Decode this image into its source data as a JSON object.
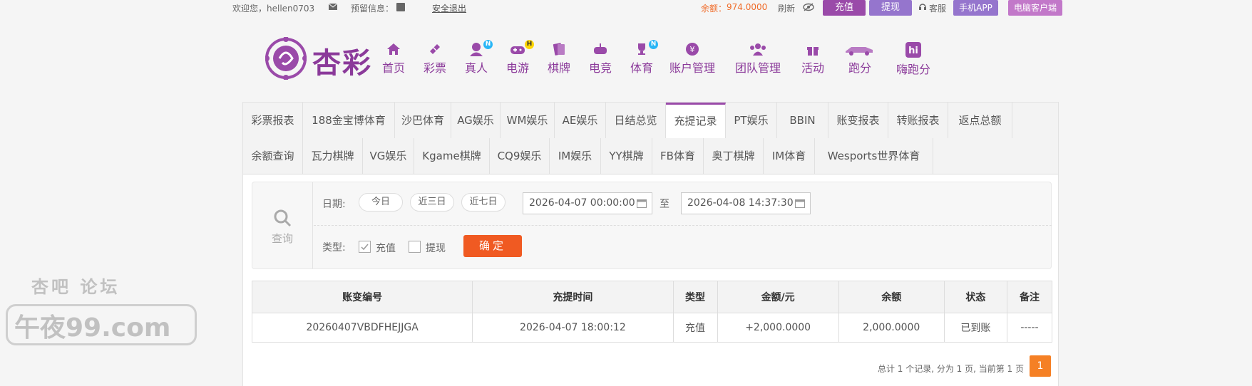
{
  "topbar": {
    "welcome": "欢迎您，hellen0703",
    "notice": "预留信息：",
    "logout": "安全退出",
    "balance_label": "余额：",
    "balance_value": "974.0000",
    "refresh": "刷新",
    "deposit": "充值",
    "withdraw": "提现",
    "service": "客服",
    "app": "手机APP",
    "pc_client": "电脑客户端"
  },
  "brand": {
    "logo_text": "杏彩"
  },
  "nav": [
    {
      "label": "首页",
      "icon": "home-icon"
    },
    {
      "label": "彩票",
      "icon": "lottery-icon"
    },
    {
      "label": "真人",
      "icon": "live-dealer-icon",
      "badge": "N"
    },
    {
      "label": "电游",
      "icon": "gamepad-icon",
      "badge": "H"
    },
    {
      "label": "棋牌",
      "icon": "cards-icon"
    },
    {
      "label": "电竞",
      "icon": "esports-icon"
    },
    {
      "label": "体育",
      "icon": "trophy-icon",
      "badge": "N"
    },
    {
      "label": "账户管理",
      "icon": "account-icon"
    },
    {
      "label": "团队管理",
      "icon": "team-icon"
    },
    {
      "label": "活动",
      "icon": "gift-icon"
    },
    {
      "label": "跑分",
      "icon": "racecar-icon"
    },
    {
      "label": "嗨跑分",
      "icon": "hi-icon"
    }
  ],
  "tabs_row1": [
    "彩票报表",
    "188金宝博体育",
    "沙巴体育",
    "AG娱乐",
    "WM娱乐",
    "AE娱乐",
    "日结总览",
    "充提记录",
    "PT娱乐",
    "BBIN",
    "账变报表",
    "转账报表",
    "返点总额"
  ],
  "tabs_row2": [
    "余额查询",
    "瓦力棋牌",
    "VG娱乐",
    "Kgame棋牌",
    "CQ9娱乐",
    "IM娱乐",
    "YY棋牌",
    "FB体育",
    "奥丁棋牌",
    "IM体育",
    "Wesports世界体育"
  ],
  "active_tab": "充提记录",
  "filter": {
    "query_label": "查询",
    "date_label": "日期:",
    "quick": [
      "今日",
      "近三日",
      "近七日"
    ],
    "date_from": "2026-04-07 00:00:00",
    "date_to": "2026-04-08 14:37:30",
    "to_label": "至",
    "type_label": "类型:",
    "type_deposit": "充值",
    "type_withdraw": "提现",
    "deposit_checked": true,
    "withdraw_checked": false,
    "confirm": "确定"
  },
  "table": {
    "headers": [
      "账变编号",
      "充提时间",
      "类型",
      "金额/元",
      "余额",
      "状态",
      "备注"
    ],
    "rows": [
      [
        "20260407VBDFHEJJGA",
        "2026-04-07 18:00:12",
        "充值",
        "+2,000.0000",
        "2,000.0000",
        "已到账",
        "-----"
      ]
    ]
  },
  "pager": {
    "info": "总计 1 个记录, 分为 1 页, 当前第 1 页",
    "current": "1"
  },
  "watermark": {
    "top": "杏吧  论坛",
    "bottom": "午夜99.com"
  },
  "colors": {
    "brand_purple": "#8b3a9a",
    "accent_orange": "#f05a22",
    "balance_orange": "#f06c2a"
  }
}
